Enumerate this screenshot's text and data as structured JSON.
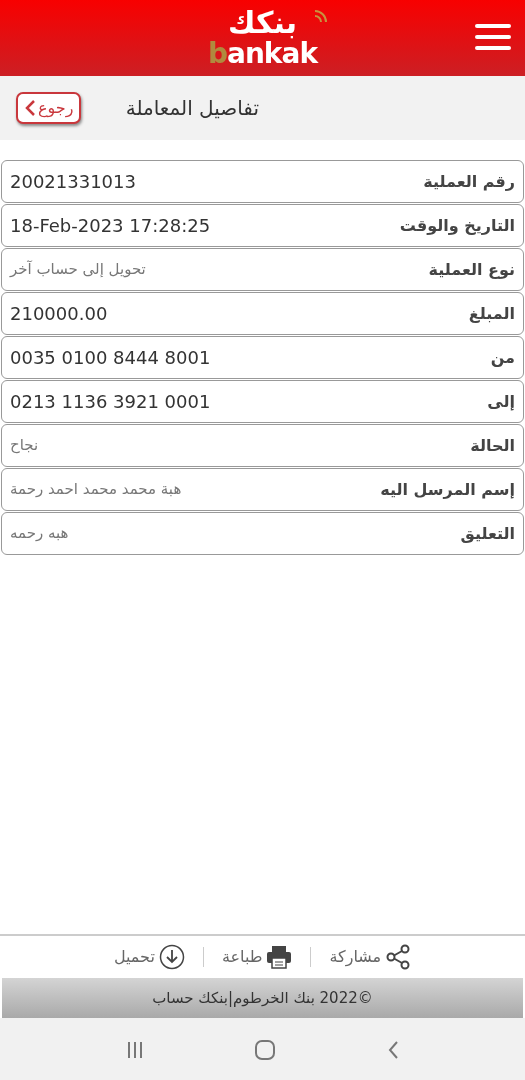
{
  "header": {
    "logo_arabic": "بنكك",
    "logo_latin_accent": "b",
    "logo_latin_rest": "ankak"
  },
  "title_bar": {
    "back_button": "رجوع",
    "title": "تفاصيل المعاملة"
  },
  "details": [
    {
      "label": "رقم العملية",
      "value": "20021331013",
      "kind": "code"
    },
    {
      "label": "التاريخ والوقت",
      "value": "18-Feb-2023 17:28:25",
      "kind": "code"
    },
    {
      "label": "نوع العملية",
      "value": "تحويل إلى حساب آخر",
      "kind": "text"
    },
    {
      "label": "المبلغ",
      "value": "210000.00",
      "kind": "code"
    },
    {
      "label": "من",
      "value": "0035 0100 8444 8001",
      "kind": "code"
    },
    {
      "label": "إلى",
      "value": "0213 1136 3921 0001",
      "kind": "code"
    },
    {
      "label": "الحالة",
      "value": "نجاح",
      "kind": "text"
    },
    {
      "label": "إسم المرسل اليه",
      "value": "هبة محمد محمد احمد رحمة",
      "kind": "text"
    },
    {
      "label": "التعليق",
      "value": "هبه رحمه",
      "kind": "text"
    }
  ],
  "actions": [
    {
      "label": "مشاركة",
      "kind": "share"
    },
    {
      "label": "طباعة",
      "kind": "print"
    },
    {
      "label": "تحميل",
      "kind": "download"
    }
  ],
  "footer": {
    "copyright": "©2022 بنك الخرطوم|بنكك حساب"
  }
}
